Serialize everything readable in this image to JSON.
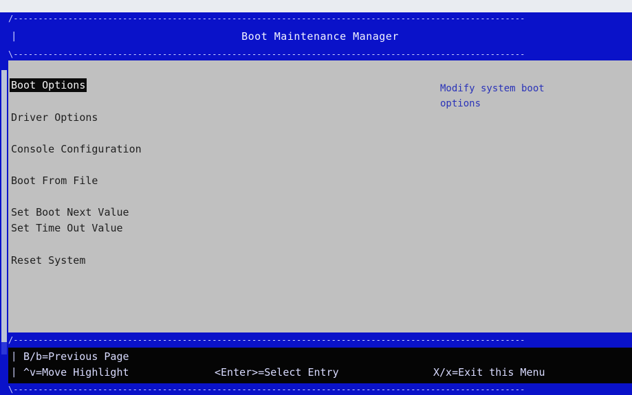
{
  "header": {
    "dash_line": "/-------------------------------------------------------------------------------------------------------",
    "title": "Boot Maintenance Manager",
    "dash_line_bottom": "\\-------------------------------------------------------------------------------------------------------",
    "pipe": "|"
  },
  "menu": {
    "items": [
      {
        "label": "Boot Options",
        "selected": true
      },
      {
        "label": "Driver Options"
      },
      {
        "label": "Console Configuration"
      },
      {
        "label": "Boot From File"
      },
      {
        "label": "Set Boot Next Value"
      },
      {
        "label": "Set Time Out Value"
      },
      {
        "label": "Reset System"
      }
    ]
  },
  "help": {
    "line1": "Modify system boot",
    "line2": "options"
  },
  "footer": {
    "dash_line": "/-------------------------------------------------------------------------------------------------------",
    "previous_page": "B/b=Previous Page",
    "move_highlight": "^v=Move Highlight",
    "select_entry": "<Enter>=Select Entry",
    "exit_menu": "X/x=Exit this Menu",
    "dash_line_bottom": "\\-------------------------------------------------------------------------------------------------------",
    "pipe": "|"
  },
  "colors": {
    "frame_blue": "#0a12c9",
    "panel_gray": "#c0c0c0",
    "help_text": "#2a33b8",
    "highlight_bg": "#0b0b0b"
  }
}
